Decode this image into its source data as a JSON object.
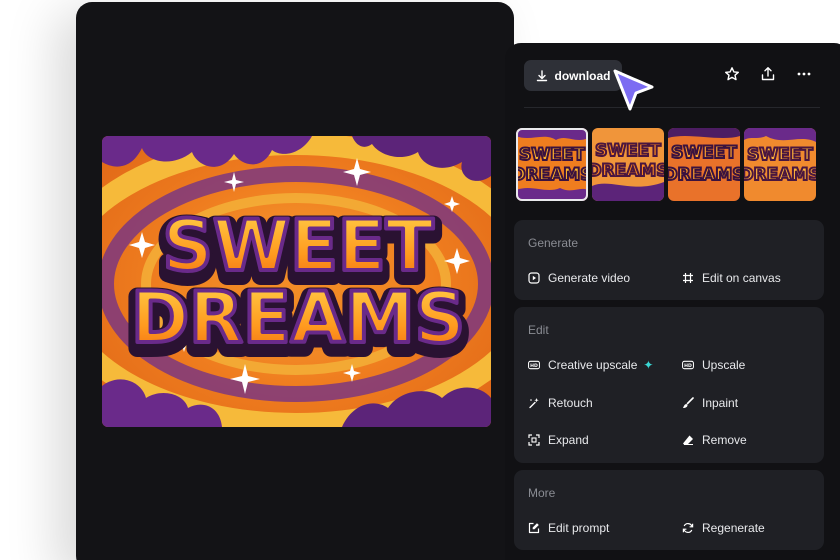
{
  "artwork": {
    "line1": "SWEET",
    "line2": "DREAMS",
    "thumb_line1": "SWEET",
    "thumb_line2": "DREAMS"
  },
  "toolbar": {
    "download_label": "download",
    "icons": [
      "star-icon",
      "share-icon",
      "more-icon"
    ]
  },
  "sections": {
    "generate": {
      "title": "Generate",
      "items": [
        {
          "label": "Generate video",
          "icon": "play-icon"
        },
        {
          "label": "Edit on canvas",
          "icon": "canvas-icon"
        }
      ]
    },
    "edit": {
      "title": "Edit",
      "items": [
        {
          "label": "Creative upscale",
          "icon": "hd-plus-icon",
          "badge": "✦"
        },
        {
          "label": "Upscale",
          "icon": "hd-icon"
        },
        {
          "label": "Retouch",
          "icon": "magic-wand-icon"
        },
        {
          "label": "Inpaint",
          "icon": "brush-icon"
        },
        {
          "label": "Expand",
          "icon": "expand-icon"
        },
        {
          "label": "Remove",
          "icon": "eraser-icon"
        }
      ]
    },
    "more": {
      "title": "More",
      "items": [
        {
          "label": "Edit prompt",
          "icon": "edit-prompt-icon"
        },
        {
          "label": "Regenerate",
          "icon": "regenerate-icon"
        }
      ]
    }
  },
  "colors": {
    "accent_cursor": "#7c6cf2",
    "sparkle": "#3ad7d4",
    "panel_bg": "#111114",
    "section_bg": "#1f2025"
  }
}
